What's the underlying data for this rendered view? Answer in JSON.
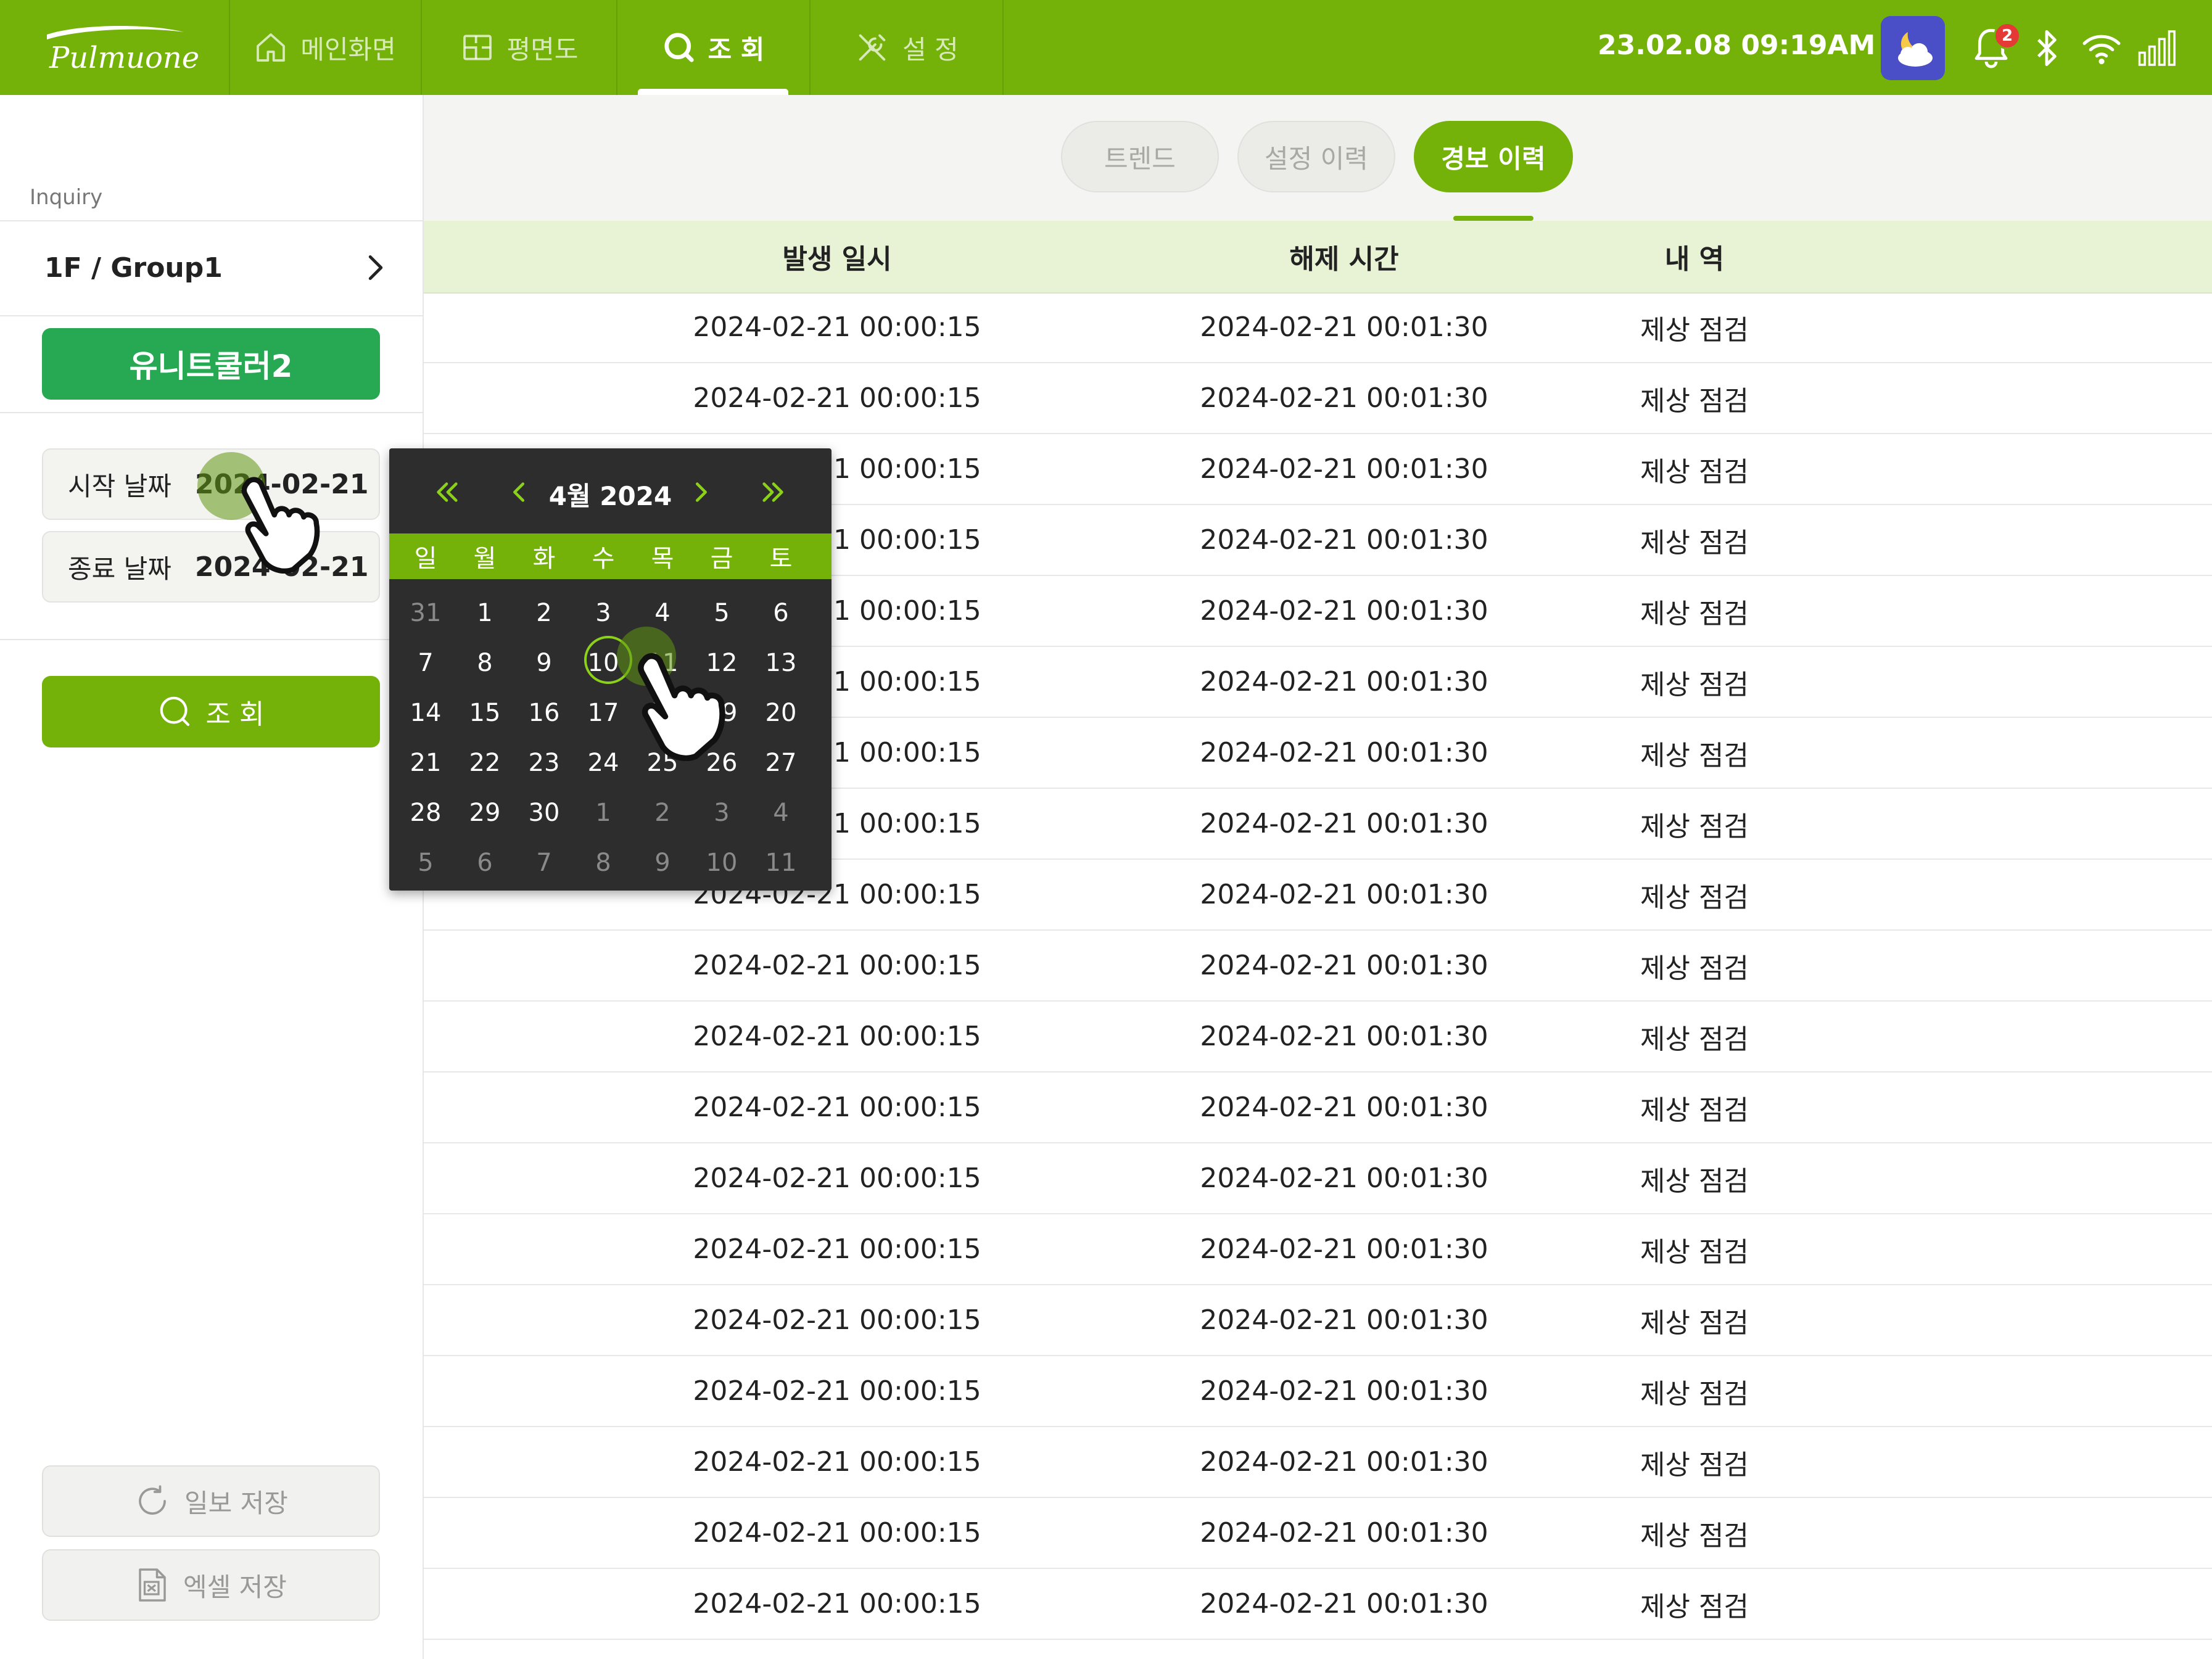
{
  "brand": {
    "logo_text": "Pulmuone"
  },
  "topbar": {
    "tabs": [
      {
        "label": "메인화면",
        "icon": "home-icon",
        "active": false
      },
      {
        "label": "평면도",
        "icon": "floorplan-icon",
        "active": false
      },
      {
        "label": "조 회",
        "icon": "search-icon",
        "active": true
      },
      {
        "label": "설 정",
        "icon": "tools-icon",
        "active": false
      }
    ],
    "datetime": "23.02.08  09:19AM",
    "weather_icon": "moon-cloud-icon",
    "notification_count": "2",
    "status_icons": [
      "bell-icon",
      "bluetooth-icon",
      "wifi-icon",
      "signal-icon"
    ]
  },
  "sidebar": {
    "section_label": "Inquiry",
    "group": "1F / Group1",
    "unit_button": "유니트쿨러2",
    "start_date": {
      "label": "시작 날짜",
      "value": "2024-02-21"
    },
    "end_date": {
      "label": "종료 날짜",
      "value": "2024-02-21"
    },
    "search_button": "조 회",
    "daily_save": "일보 저장",
    "excel_save": "엑셀 저장"
  },
  "subtabs": [
    {
      "label": "트렌드",
      "active": false
    },
    {
      "label": "설정 이력",
      "active": false
    },
    {
      "label": "경보 이력",
      "active": true
    }
  ],
  "table": {
    "headers": [
      "발생 일시",
      "해제 시간",
      "내 역"
    ],
    "rows": [
      [
        "2024-02-21 00:00:15",
        "2024-02-21 00:01:30",
        "제상 점검"
      ],
      [
        "2024-02-21 00:00:15",
        "2024-02-21 00:01:30",
        "제상 점검"
      ],
      [
        "2024-02-21 00:00:15",
        "2024-02-21 00:01:30",
        "제상 점검"
      ],
      [
        "2024-02-21 00:00:15",
        "2024-02-21 00:01:30",
        "제상 점검"
      ],
      [
        "2024-02-21 00:00:15",
        "2024-02-21 00:01:30",
        "제상 점검"
      ],
      [
        "2024-02-21 00:00:15",
        "2024-02-21 00:01:30",
        "제상 점검"
      ],
      [
        "2024-02-21 00:00:15",
        "2024-02-21 00:01:30",
        "제상 점검"
      ],
      [
        "2024-02-21 00:00:15",
        "2024-02-21 00:01:30",
        "제상 점검"
      ],
      [
        "2024-02-21 00:00:15",
        "2024-02-21 00:01:30",
        "제상 점검"
      ],
      [
        "2024-02-21 00:00:15",
        "2024-02-21 00:01:30",
        "제상 점검"
      ],
      [
        "2024-02-21 00:00:15",
        "2024-02-21 00:01:30",
        "제상 점검"
      ],
      [
        "2024-02-21 00:00:15",
        "2024-02-21 00:01:30",
        "제상 점검"
      ],
      [
        "2024-02-21 00:00:15",
        "2024-02-21 00:01:30",
        "제상 점검"
      ],
      [
        "2024-02-21 00:00:15",
        "2024-02-21 00:01:30",
        "제상 점검"
      ],
      [
        "2024-02-21 00:00:15",
        "2024-02-21 00:01:30",
        "제상 점검"
      ],
      [
        "2024-02-21 00:00:15",
        "2024-02-21 00:01:30",
        "제상 점검"
      ],
      [
        "2024-02-21 00:00:15",
        "2024-02-21 00:01:30",
        "제상 점검"
      ],
      [
        "2024-02-21 00:00:15",
        "2024-02-21 00:01:30",
        "제상 점검"
      ],
      [
        "2024-02-21 00:00:15",
        "2024-02-21 00:01:30",
        "제상 점검"
      ]
    ]
  },
  "calendar": {
    "month_label": "4월 2024",
    "weekdays": [
      "일",
      "월",
      "화",
      "수",
      "목",
      "금",
      "토"
    ],
    "weeks": [
      [
        "31",
        "1",
        "2",
        "3",
        "4",
        "5",
        "6"
      ],
      [
        "7",
        "8",
        "9",
        "10",
        "11",
        "12",
        "13"
      ],
      [
        "14",
        "15",
        "16",
        "17",
        "18",
        "19",
        "20"
      ],
      [
        "21",
        "22",
        "23",
        "24",
        "25",
        "26",
        "27"
      ],
      [
        "28",
        "29",
        "30",
        "1",
        "2",
        "3",
        "4"
      ],
      [
        "5",
        "6",
        "7",
        "8",
        "9",
        "10",
        "11"
      ]
    ],
    "selected_day": "10"
  },
  "colors": {
    "brand_green": "#74b20a",
    "unit_green": "#27a853",
    "header_tint": "#e8f2d5",
    "calendar_bg": "#2d2d2d"
  }
}
